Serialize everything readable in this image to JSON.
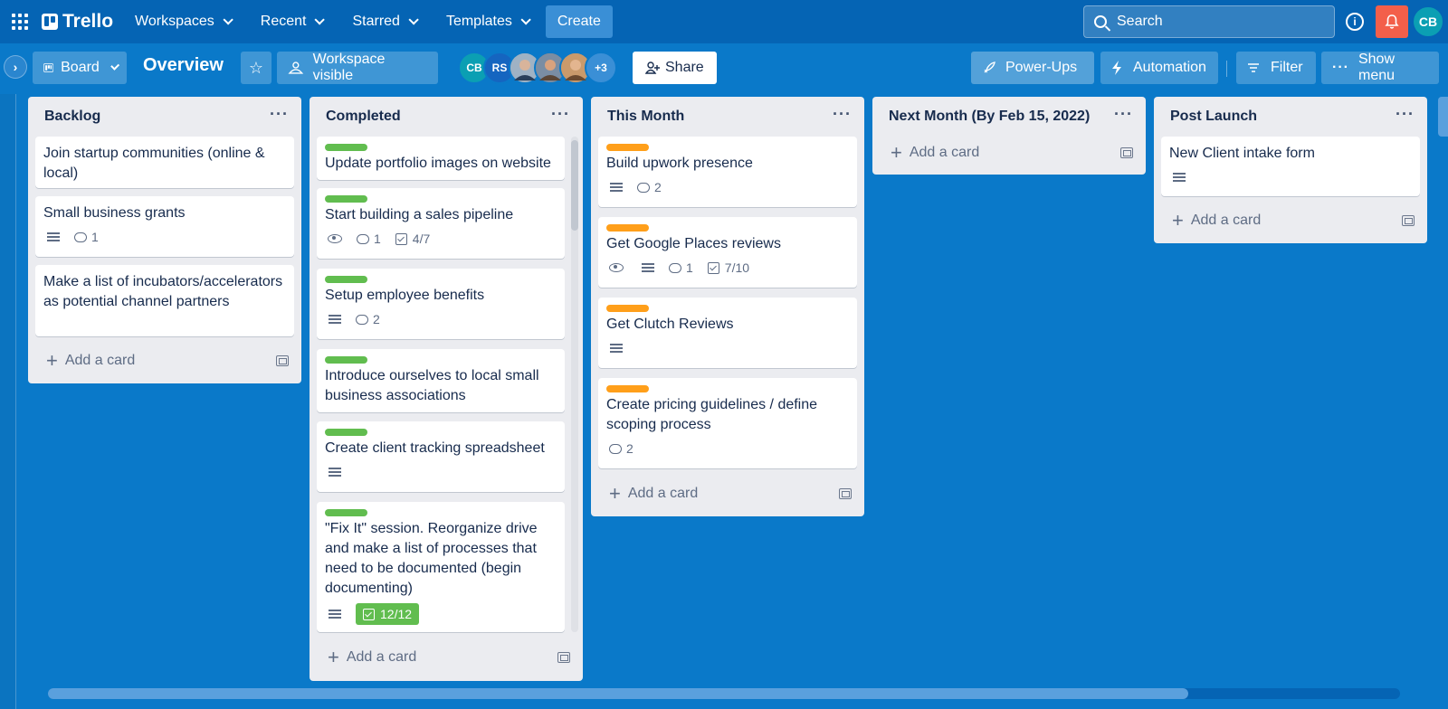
{
  "topnav": {
    "logo": "Trello",
    "items": [
      "Workspaces",
      "Recent",
      "Starred",
      "Templates"
    ],
    "create_label": "Create",
    "search_placeholder": "Search",
    "avatar": "CB"
  },
  "board": {
    "view_label": "Board",
    "title": "Overview",
    "visibility_label": "Workspace visible",
    "members": [
      {
        "initials": "CB",
        "color": "#0b9fb3"
      },
      {
        "initials": "RS",
        "color": "#1565c0"
      },
      {
        "initials": "",
        "color": "#8aa3b8"
      },
      {
        "initials": "",
        "color": "#b07c5b"
      },
      {
        "initials": "",
        "color": "#c58a5e"
      }
    ],
    "more_members": "+3",
    "share_label": "Share",
    "powerups_label": "Power-Ups",
    "automation_label": "Automation",
    "filter_label": "Filter",
    "show_menu_label": "Show menu"
  },
  "add_card_label": "Add a card",
  "colors": {
    "green_label": "#61bd4f",
    "orange_label": "#ff9f1a",
    "bell": "#f35f4a"
  },
  "lists": [
    {
      "title": "Backlog",
      "cards": [
        {
          "title": "Join startup communities (online & local)"
        },
        {
          "title": "Small business grants",
          "comments": "1"
        },
        {
          "title": "Make a list of incubators/accelerators as potential channel partners"
        }
      ]
    },
    {
      "title": "Completed",
      "cards": [
        {
          "title": "Update portfolio images on website"
        },
        {
          "title": "Start building a sales pipeline",
          "comments": "1",
          "checklist": "4/7"
        },
        {
          "title": "Setup employee benefits",
          "comments": "2"
        },
        {
          "title": "Introduce ourselves to local small business associations"
        },
        {
          "title": "Create client tracking spreadsheet"
        },
        {
          "title": "\"Fix It\" session. Reorganize drive and make a list of processes that need to be documented (begin documenting)",
          "checklist": "12/12"
        }
      ]
    },
    {
      "title": "This Month",
      "cards": [
        {
          "title": "Build upwork presence",
          "comments": "2"
        },
        {
          "title": "Get Google Places reviews",
          "comments": "1",
          "checklist": "7/10"
        },
        {
          "title": "Get Clutch Reviews"
        },
        {
          "title": "Create pricing guidelines / define scoping process",
          "comments": "2"
        }
      ]
    },
    {
      "title": "Next Month (By Feb 15, 2022)",
      "cards": []
    },
    {
      "title": "Post Launch",
      "cards": [
        {
          "title": "New Client intake form"
        }
      ]
    }
  ]
}
